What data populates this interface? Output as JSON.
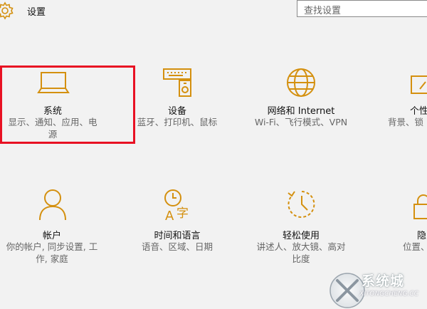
{
  "header": {
    "title": "设置",
    "search_placeholder": "查找设置"
  },
  "colors": {
    "accent": "#d4900f",
    "selection": "#e81123"
  },
  "tiles": [
    {
      "name": "系统",
      "desc_line1": "显示、通知、应用、电",
      "desc_line2": "源",
      "icon": "laptop-icon"
    },
    {
      "name": "设备",
      "desc_line1": "蓝牙、打印机、鼠标",
      "icon": "devices-icon"
    },
    {
      "name": "网络和 Internet",
      "desc_line1": "Wi-Fi、飞行模式、VPN",
      "icon": "globe-icon"
    },
    {
      "name": "个性",
      "desc_line1": "背景、锁",
      "icon": "personalization-icon"
    },
    {
      "name": "帐户",
      "desc_line1": "你的帐户, 同步设置, 工",
      "desc_line2": "作, 家庭",
      "icon": "person-icon"
    },
    {
      "name": "时间和语言",
      "desc_line1": "语音、区域、日期",
      "icon": "time-language-icon"
    },
    {
      "name": "轻松使用",
      "desc_line1": "讲述人、放大镜、高对",
      "desc_line2": "比度",
      "icon": "ease-of-access-icon"
    },
    {
      "name": "隐",
      "desc_line1": "位置、",
      "icon": "privacy-icon"
    }
  ],
  "watermark": {
    "brand": "系统城",
    "url": "XITONGCHENG.CC"
  }
}
